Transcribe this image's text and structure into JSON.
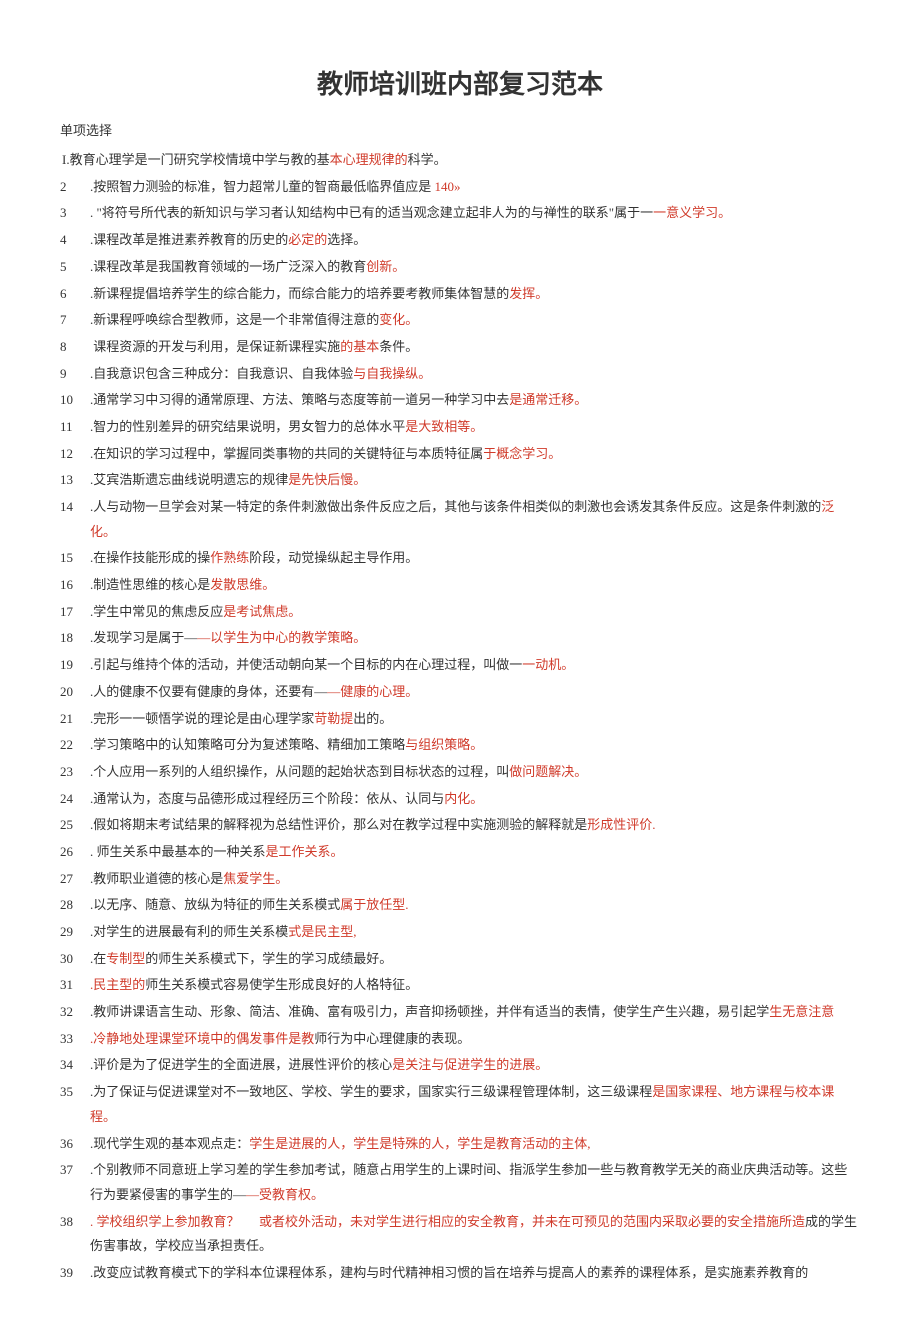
{
  "title": "教师培训班内部复习范本",
  "section": "单项选择",
  "items": [
    {
      "n": "",
      "html": "I.教育心理学是一门研究学校情境中学与教的基<span class='red'>本心理规律的</span>科学。"
    },
    {
      "n": "2",
      "html": ".按照智力测验的标准，智力超常儿童的智商最低临界值应是 <span class='red'>140»</span>"
    },
    {
      "n": "3",
      "html": ". \"将符号所代表的新知识与学习者认知结构中已有的适当观念建立起非人为的与禅性的联系\"属于一<span class='red'>一意义学习。</span>"
    },
    {
      "n": "4",
      "html": ".课程改革是推进素养教育的历史的<span class='red'>必定的</span>选择。"
    },
    {
      "n": "5",
      "html": ".课程改革是我国教育领域的一场广泛深入的教育<span class='red'>创新。</span>"
    },
    {
      "n": "6",
      "html": ".新课程提倡培养学生的综合能力，而综合能力的培养要考教师集体智慧的<span class='red'>发挥。</span>"
    },
    {
      "n": "7",
      "html": ".新课程呼唤综合型教师，这是一个非常值得注意的<span class='red'>变化。</span>"
    },
    {
      "n": "8",
      "html": "&nbsp;课程资源的开发与利用，是保证新课程实施<span class='red'>的基本</span>条件。"
    },
    {
      "n": "9",
      "html": ".自我意识包含三种成分：自我意识、自我体验<span class='red'>与自我操纵。</span>"
    },
    {
      "n": "10",
      "html": ".通常学习中习得的通常原理、方法、策略与态度等前一道另一种学习中去<span class='red'>是通常迁移。</span>"
    },
    {
      "n": "11",
      "html": ".智力的性别差异的研究结果说明，男女智力的总体水平<span class='red'>是大致相等。</span>"
    },
    {
      "n": "12",
      "html": ".在知识的学习过程中，掌握同类事物的共同的关键特征与本质特征属<span class='red'>于概念学习。</span>"
    },
    {
      "n": "13",
      "html": ".艾宾浩斯遗忘曲线说明遗忘的规律<span class='red'>是先快后慢。</span>"
    },
    {
      "n": "14",
      "html": ".人与动物一旦学会对某一特定的条件刺激做出条件反应之后，其他与该条件相类似的刺激也会诱发其条件反应。这是条件刺激的<span class='red'>泛化。</span>"
    },
    {
      "n": "15",
      "html": ".在操作技能形成的操<span class='red'>作熟练</span>阶段，动觉操纵起主导作用。"
    },
    {
      "n": "16",
      "html": ".制造性思维的核心是<span class='red'>发散思维。</span>"
    },
    {
      "n": "17",
      "html": ".学生中常见的焦虑反应<span class='red'>是考试焦虑。</span>"
    },
    {
      "n": "18",
      "html": ".发现学习是属于—<span class='red'>—以学生为中心的教学策略。</span>"
    },
    {
      "n": "19",
      "html": ".引起与维持个体的活动，并使活动朝向某一个目标的内在心理过程，叫做一<span class='red'>一动机。</span>"
    },
    {
      "n": "20",
      "html": ".人的健康不仅要有健康的身体，还要有—<span class='red'>—健康的心理。</span>"
    },
    {
      "n": "21",
      "html": ".完形一一顿悟学说的理论是由心理学家<span class='red'>苛勒提</span>出的。"
    },
    {
      "n": "22",
      "html": ".学习策略中的认知策略可分为复述策略、精细加工策略<span class='red'>与组织策略。</span>"
    },
    {
      "n": "23",
      "html": ".个人应用一系列的人组织操作，从问题的起始状态到目标状态的过程，叫<span class='red'>做问题解决。</span>"
    },
    {
      "n": "24",
      "html": ".通常认为，态度与品德形成过程经历三个阶段：依从、认同与<span class='red'>内化。</span>"
    },
    {
      "n": "25",
      "html": ".假如将期末考试结果的解释视为总结性评价，那么对在教学过程中实施测验的解释就是<span class='red'>形成性评价.</span>"
    },
    {
      "n": "26",
      "html": ". 师生关系中最基本的一种关系<span class='red'>是工作关系。</span>"
    },
    {
      "n": "27",
      "html": ".教师职业道德的核心是<span class='red'>焦爱学生。</span>"
    },
    {
      "n": "28",
      "html": ".以无序、随意、放纵为特征的师生关系模式<span class='red'>属于放任型.</span>"
    },
    {
      "n": "29",
      "html": ".对学生的进展最有利的师生关系模<span class='red'>式是民主型,</span>"
    },
    {
      "n": "30",
      "html": ".在<span class='red'>专制型</span>的师生关系模式下，学生的学习成绩最好。"
    },
    {
      "n": "31",
      "html": "<span class='red'>.民主型的</span>师生关系模式容易使学生形成良好的人格特征。"
    },
    {
      "n": "32",
      "html": ".教师讲课语言生动、形象、简洁、准确、富有吸引力，声音抑扬顿挫，并伴有适当的表情，使学生产生兴趣，易引起学<span class='red'>生无意注意</span>"
    },
    {
      "n": "33",
      "html": "<span class='red'>.冷静地处理课堂环境中的偶发事件是教</span>师行为中心理健康的表现。"
    },
    {
      "n": "34",
      "html": ".评价是为了促进学生的全面进展，进展性评价的核心<span class='red'>是关注与促进学生的进展。</span>"
    },
    {
      "n": "35",
      "html": ".为了保证与促进课堂对不一致地区、学校、学生的要求，国家实行三级课程管理体制，这三级课程<span class='red'>是国家课程、地方课程与校本课程。</span>"
    },
    {
      "n": "36",
      "html": ".现代学生观的基本观点走：<span class='red'>学生是进展的人，学生是特殊的人，学生是教育活动的主体,</span>"
    },
    {
      "n": "37",
      "html": ".个别教师不同意班上学习差的学生参加考试，随意占用学生的上课时间、指派学生参加一些与教育教学无关的商业庆典活动等。这些行为要紧侵害的事学生的—<span class='red'>—受教育权。</span>"
    },
    {
      "n": "38",
      "html": "<span class='red'>. 学校组织学上参加教育？&nbsp;&nbsp;&nbsp;&nbsp;&nbsp;&nbsp;或者校外活动，未对学生进行相应的安全教育，并未在可预见的范围内采取必要的安全措施所造</span>成的学生伤害事故，学校应当承担责任。"
    },
    {
      "n": "39",
      "html": ".改变应试教育模式下的学科本位课程体系，建构与时代精神相习惯的旨在培养与提高人的素养的课程体系，是实施素养教育的"
    }
  ]
}
